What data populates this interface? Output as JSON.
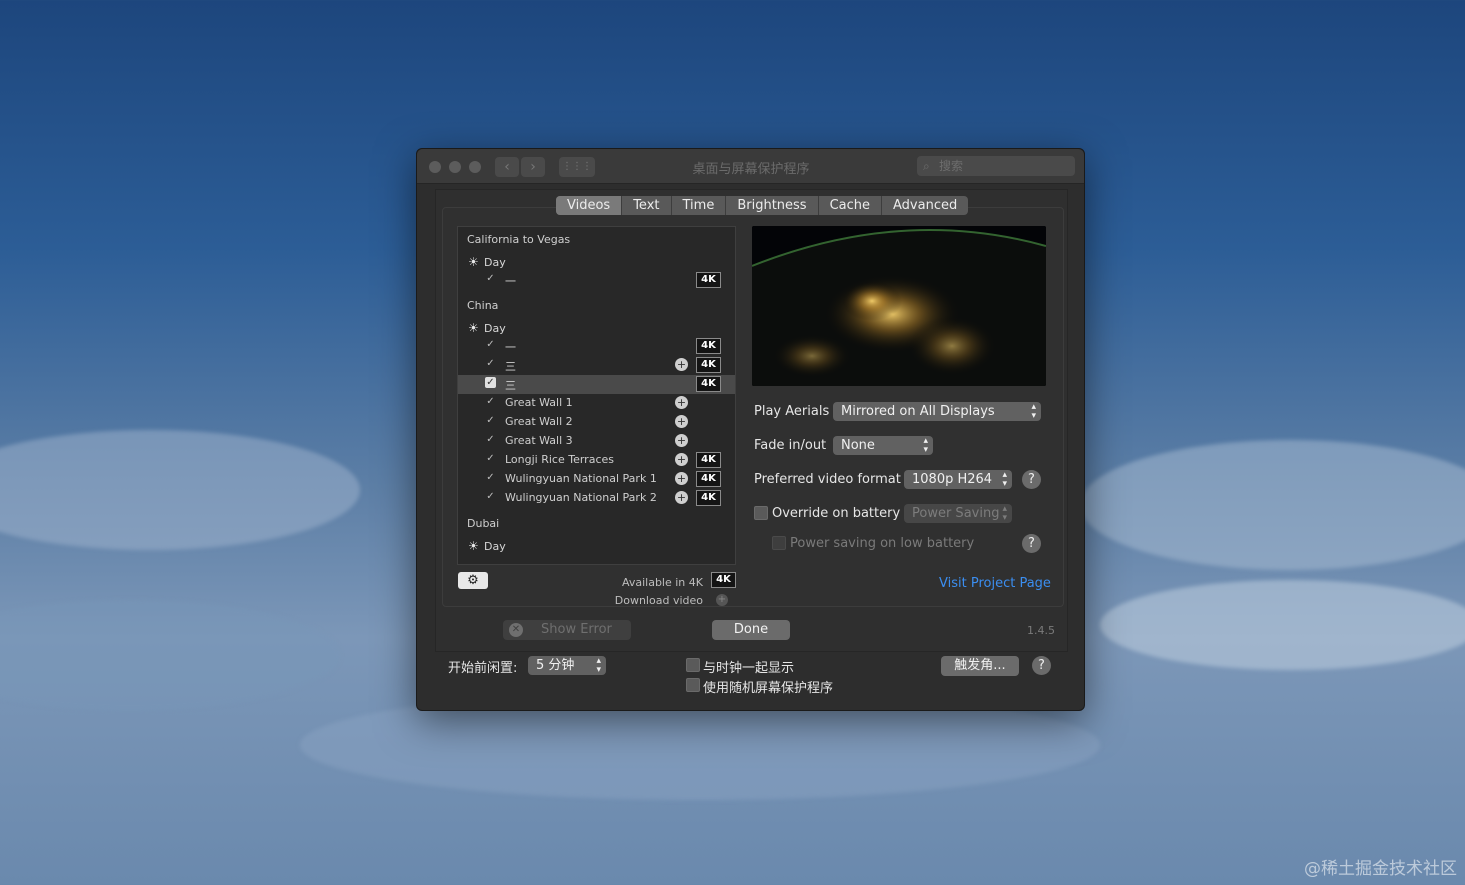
{
  "window": {
    "title": "桌面与屏幕保护程序",
    "search_placeholder": "搜索",
    "search_icon": "search-icon"
  },
  "tabs": [
    "Videos",
    "Text",
    "Time",
    "Brightness",
    "Cache",
    "Advanced"
  ],
  "active_tab": "Videos",
  "list": {
    "groups": [
      {
        "name": "California to Vegas",
        "sub": "Day"
      },
      {
        "name": "China",
        "sub": "Day"
      },
      {
        "name": "Dubai",
        "sub": "Day"
      }
    ],
    "items": [
      {
        "label": "一",
        "download": false,
        "badge": "4K",
        "selected": false
      },
      {
        "label": "一",
        "download": false,
        "badge": "4K",
        "selected": false
      },
      {
        "label": "三",
        "download": true,
        "badge": "4K",
        "selected": false
      },
      {
        "label": "三",
        "download": false,
        "badge": "4K",
        "selected": true
      },
      {
        "label": "Great Wall 1",
        "download": true,
        "badge": "",
        "selected": false
      },
      {
        "label": "Great Wall 2",
        "download": true,
        "badge": "",
        "selected": false
      },
      {
        "label": "Great Wall 3",
        "download": true,
        "badge": "",
        "selected": false
      },
      {
        "label": "Longji Rice Terraces",
        "download": true,
        "badge": "4K",
        "selected": false
      },
      {
        "label": "Wulingyuan National Park 1",
        "download": true,
        "badge": "4K",
        "selected": false
      },
      {
        "label": "Wulingyuan National Park 2",
        "download": true,
        "badge": "4K",
        "selected": false
      }
    ],
    "legend_available": "Available in 4K",
    "legend_available_badge": "4K",
    "legend_download": "Download video"
  },
  "settings": {
    "play_aerials_label": "Play Aerials",
    "play_aerials_value": "Mirrored on All Displays",
    "fade_label": "Fade in/out",
    "fade_value": "None",
    "format_label": "Preferred video format",
    "format_value": "1080p H264",
    "override_label": "Override on battery",
    "override_value": "Power Saving",
    "low_battery_label": "Power saving on low battery",
    "help": "?",
    "project_link": "Visit Project Page"
  },
  "footer": {
    "show_error": "Show Error",
    "done": "Done",
    "version": "1.4.5"
  },
  "bottom": {
    "idle_label": "开始前闲置:",
    "idle_value": "5 分钟",
    "show_clock": "与时钟一起显示",
    "random_saver": "使用随机屏幕保护程序",
    "hot_corners": "触发角...",
    "help": "?"
  },
  "watermark": "@稀土掘金技术社区"
}
